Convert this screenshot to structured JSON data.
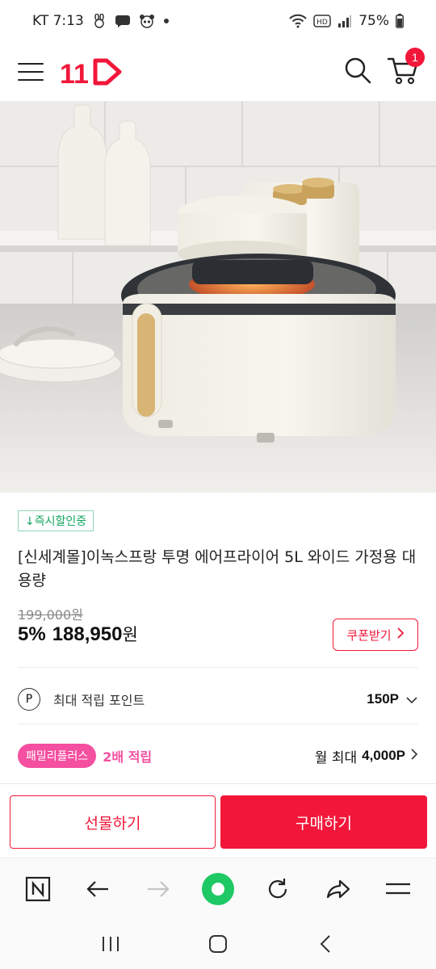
{
  "status_bar": {
    "carrier_time": "KT 7:13",
    "battery": "75%"
  },
  "header": {
    "logo_text": "11",
    "cart_count": "1"
  },
  "product": {
    "tag": "↓즉시할인중",
    "title": "[신세계몰]이녹스프랑 투명 에어프라이어 5L 와이드 가정용 대용량",
    "original_price": "199,000원",
    "discount_rate": "5%",
    "sale_price": "188,950",
    "currency": "원",
    "coupon_button": "쿠폰받기"
  },
  "points": {
    "icon_letter": "P",
    "label": "최대 적립 포인트",
    "value": "150P"
  },
  "family_plus": {
    "badge": "패밀리플러스",
    "bonus": "2배 적립",
    "monthly_label": "월 최대",
    "monthly_value": "4,000P"
  },
  "actions": {
    "gift": "선물하기",
    "buy": "구매하기"
  },
  "colors": {
    "accent": "#f2173a",
    "family": "#f44fa0",
    "tag_green": "#15a561"
  }
}
